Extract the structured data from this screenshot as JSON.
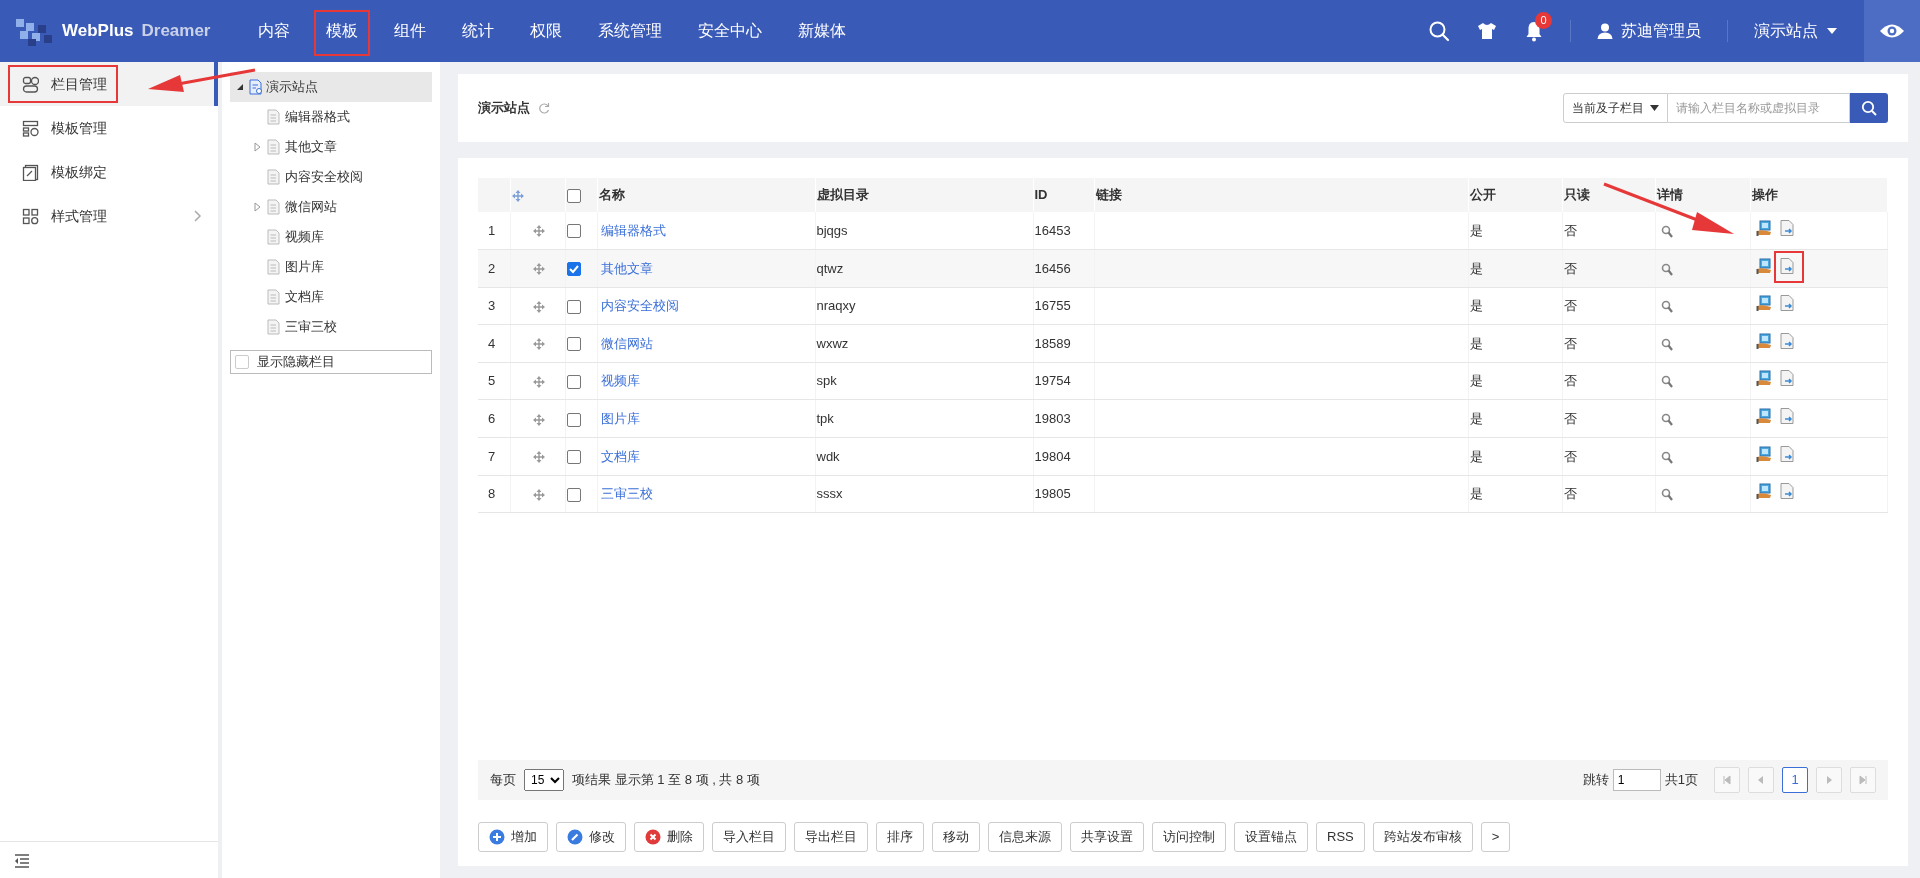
{
  "brand": {
    "name": "WebPlus",
    "sub": "Dreamer"
  },
  "top_nav": [
    {
      "label": "内容",
      "highlighted": false
    },
    {
      "label": "模板",
      "highlighted": true
    },
    {
      "label": "组件",
      "highlighted": false
    },
    {
      "label": "统计",
      "highlighted": false
    },
    {
      "label": "权限",
      "highlighted": false
    },
    {
      "label": "系统管理",
      "highlighted": false
    },
    {
      "label": "安全中心",
      "highlighted": false
    },
    {
      "label": "新媒体",
      "highlighted": false
    }
  ],
  "notifications": {
    "count": "0"
  },
  "user": {
    "name": "苏迪管理员"
  },
  "site_menu": {
    "label": "演示站点"
  },
  "sidebar": {
    "items": [
      {
        "label": "栏目管理",
        "kind": "columns",
        "selected": true,
        "highlighted": true,
        "has_submenu": false
      },
      {
        "label": "模板管理",
        "kind": "templates",
        "selected": false,
        "highlighted": false,
        "has_submenu": false
      },
      {
        "label": "模板绑定",
        "kind": "binding",
        "selected": false,
        "highlighted": false,
        "has_submenu": false
      },
      {
        "label": "样式管理",
        "kind": "styles",
        "selected": false,
        "highlighted": false,
        "has_submenu": true
      }
    ]
  },
  "tree": {
    "root": {
      "label": "演示站点",
      "expanded": true,
      "selected": true,
      "children": [
        {
          "label": "编辑器格式"
        },
        {
          "label": "其他文章",
          "expanded": false
        },
        {
          "label": "内容安全校阅"
        },
        {
          "label": "微信网站",
          "expanded": false
        },
        {
          "label": "视频库"
        },
        {
          "label": "图片库"
        },
        {
          "label": "文档库"
        },
        {
          "label": "三审三校"
        }
      ]
    },
    "show_hidden": {
      "label": "显示隐藏栏目",
      "checked": false
    }
  },
  "header": {
    "title": "演示站点"
  },
  "filter": {
    "scope": "当前及子栏目",
    "placeholder": "请输入栏目名称或虚拟目录"
  },
  "table": {
    "all_checked": false,
    "columns": [
      "名称",
      "虚拟目录",
      "ID",
      "链接",
      "公开",
      "只读",
      "详情",
      "操作"
    ],
    "rows": [
      {
        "index": "1",
        "name": "编辑器格式",
        "dir": "bjqgs",
        "id": "16453",
        "public": "是",
        "readonly": "否",
        "selected": false,
        "action_highlighted": false
      },
      {
        "index": "2",
        "name": "其他文章",
        "dir": "qtwz",
        "id": "16456",
        "public": "是",
        "readonly": "否",
        "selected": true,
        "action_highlighted": true
      },
      {
        "index": "3",
        "name": "内容安全校阅",
        "dir": "nraqxy",
        "id": "16755",
        "public": "是",
        "readonly": "否",
        "selected": false,
        "action_highlighted": false
      },
      {
        "index": "4",
        "name": "微信网站",
        "dir": "wxwz",
        "id": "18589",
        "public": "是",
        "readonly": "否",
        "selected": false,
        "action_highlighted": false
      },
      {
        "index": "5",
        "name": "视频库",
        "dir": "spk",
        "id": "19754",
        "public": "是",
        "readonly": "否",
        "selected": false,
        "action_highlighted": false
      },
      {
        "index": "6",
        "name": "图片库",
        "dir": "tpk",
        "id": "19803",
        "public": "是",
        "readonly": "否",
        "selected": false,
        "action_highlighted": false
      },
      {
        "index": "7",
        "name": "文档库",
        "dir": "wdk",
        "id": "19804",
        "public": "是",
        "readonly": "否",
        "selected": false,
        "action_highlighted": false
      },
      {
        "index": "8",
        "name": "三审三校",
        "dir": "sssx",
        "id": "19805",
        "public": "是",
        "readonly": "否",
        "selected": false,
        "action_highlighted": false
      }
    ]
  },
  "pagination": {
    "per_page_label": "每页",
    "per_page": "15",
    "info": "项结果 显示第 1 至 8 项 , 共 8 项",
    "jump_label": "跳转",
    "jump_value": "1",
    "total_pages": "共1页",
    "current_page": "1"
  },
  "buttons": [
    {
      "label": "增加",
      "kind": "add"
    },
    {
      "label": "修改",
      "kind": "edit"
    },
    {
      "label": "删除",
      "kind": "delete"
    },
    {
      "label": "导入栏目",
      "kind": "plain"
    },
    {
      "label": "导出栏目",
      "kind": "plain"
    },
    {
      "label": "排序",
      "kind": "plain"
    },
    {
      "label": "移动",
      "kind": "plain"
    },
    {
      "label": "信息来源",
      "kind": "plain"
    },
    {
      "label": "共享设置",
      "kind": "plain"
    },
    {
      "label": "访问控制",
      "kind": "plain"
    },
    {
      "label": "设置锚点",
      "kind": "plain"
    },
    {
      "label": "RSS",
      "kind": "plain"
    },
    {
      "label": "跨站发布审核",
      "kind": "plain"
    },
    {
      "label": ">",
      "kind": "plain"
    }
  ]
}
